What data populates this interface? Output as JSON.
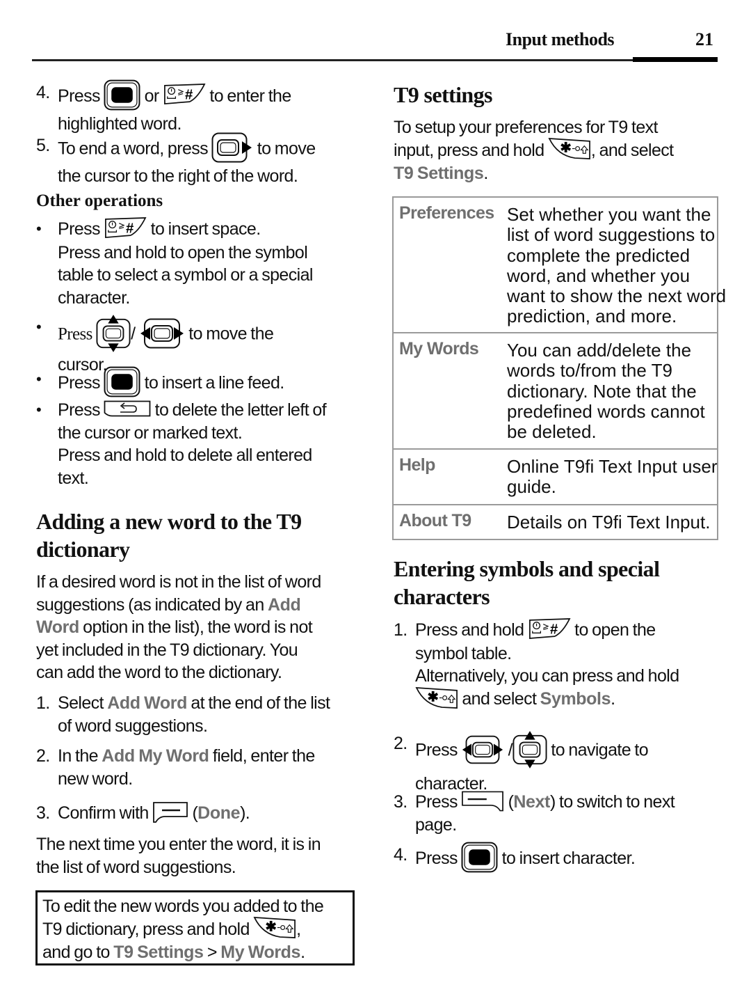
{
  "header": {
    "section_title": "Input methods",
    "page_number": "21"
  },
  "left": {
    "steps_top": [
      {
        "num": "4.",
        "parts": [
          "Press",
          "or",
          "to enter the",
          "highlighted word."
        ]
      },
      {
        "num": "5.",
        "parts": [
          "To end a word, press",
          "to move",
          "the cursor to the right of the word."
        ]
      }
    ],
    "other_operations": {
      "title": "Other operations",
      "bullets": [
        {
          "marker": "•",
          "lines": [
            "Press",
            "to insert space.",
            "Press and hold to open the symbol",
            "table to select a symbol or a special",
            "character."
          ]
        },
        {
          "marker": "•",
          "lines": [
            "Press",
            "/",
            "to move the",
            "cursor."
          ]
        },
        {
          "marker": "•",
          "lines": [
            "Press",
            "to insert a line feed."
          ]
        },
        {
          "marker": "•",
          "lines": [
            "Press",
            "to delete the letter left of",
            "the cursor or marked text.",
            "Press and hold to delete all entered",
            "text."
          ]
        }
      ]
    },
    "adding": {
      "title_line1": "Adding a new word to the T9",
      "title_line2": "dictionary",
      "intro": {
        "l1": "If a desired word is not in the list of word",
        "l2a": "suggestions (as indicated by an ",
        "l2b": "Add",
        "l3a": "Word",
        "l3b": " option in the list), the word is not",
        "l4": "yet included in the T9 dictionary. You",
        "l5": "can add the word to the dictionary."
      },
      "steps": [
        {
          "num": "1.",
          "a": "Select ",
          "hl": "Add Word",
          "b": " at the end of the list",
          "c": "of word suggestions."
        },
        {
          "num": "2.",
          "a": "In the ",
          "hl": "Add My Word",
          "b": " field, enter the",
          "c": "new word."
        },
        {
          "num": "3.",
          "a": "Confirm with",
          "hl": "Done",
          "b": "(",
          "c": ")."
        }
      ],
      "outro": {
        "l1": "The next time you enter the word, it is in",
        "l2": "the list of word suggestions."
      }
    },
    "note": {
      "l1": "To edit the new words you added to the",
      "l2a": "T9 dictionary, press and hold",
      "l2b": ",",
      "l3a": "and go to ",
      "l3b": "T9 Settings",
      "l3c": " > ",
      "l3d": "My Words",
      "l3e": "."
    }
  },
  "right": {
    "t9_settings": {
      "title": "T9 settings",
      "l1": "To setup your preferences for T9 text",
      "l2a": "input, press and hold",
      "l2b": ", and select",
      "l3a": "T9 Settings",
      "l3b": "."
    },
    "table": [
      {
        "label": "Preferences",
        "desc": [
          "Set whether you want the",
          "list of word suggestions to",
          "complete the predicted",
          "word, and whether you",
          "want to show the next word",
          "prediction, and more."
        ]
      },
      {
        "label": "My Words",
        "desc": [
          "You can add/delete the",
          "words to/from the T9",
          "dictionary. Note that the",
          "predefined words cannot",
          "be deleted."
        ]
      },
      {
        "label": "Help",
        "desc": [
          "Online T9fi Text Input user",
          "guide."
        ]
      },
      {
        "label": "About T9",
        "desc": [
          "Details on T9fi Text Input."
        ]
      }
    ],
    "symbols": {
      "title_line1": "Entering symbols and special",
      "title_line2": "characters",
      "steps": [
        {
          "num": "1.",
          "l1a": "Press and hold",
          "l1b": "to open the",
          "l2": "symbol table.",
          "l3": "Alternatively, you can press and hold",
          "l4a": "and select ",
          "l4b": "Symbols",
          "l4c": "."
        },
        {
          "num": "2.",
          "l1a": "Press",
          "l1b": "/",
          "l1c": "to navigate to",
          "l2": "character."
        },
        {
          "num": "3.",
          "l1a": "Press",
          "l1b": "(",
          "hl": "Next",
          "l1c": ") to switch to next",
          "l2": "page."
        },
        {
          "num": "4.",
          "l1a": "Press",
          "l1b": "to insert character."
        }
      ]
    }
  },
  "icons": {
    "center_key": "center-select-key",
    "hash_key": "hash-space-key",
    "right_nav": "nav-right-key",
    "updown_nav": "nav-up-down-key",
    "leftright_nav": "nav-left-right-key",
    "back_key": "back-clear-key",
    "star_key": "star-shift-key",
    "left_softkey": "left-softkey",
    "right_softkey": "right-softkey"
  }
}
